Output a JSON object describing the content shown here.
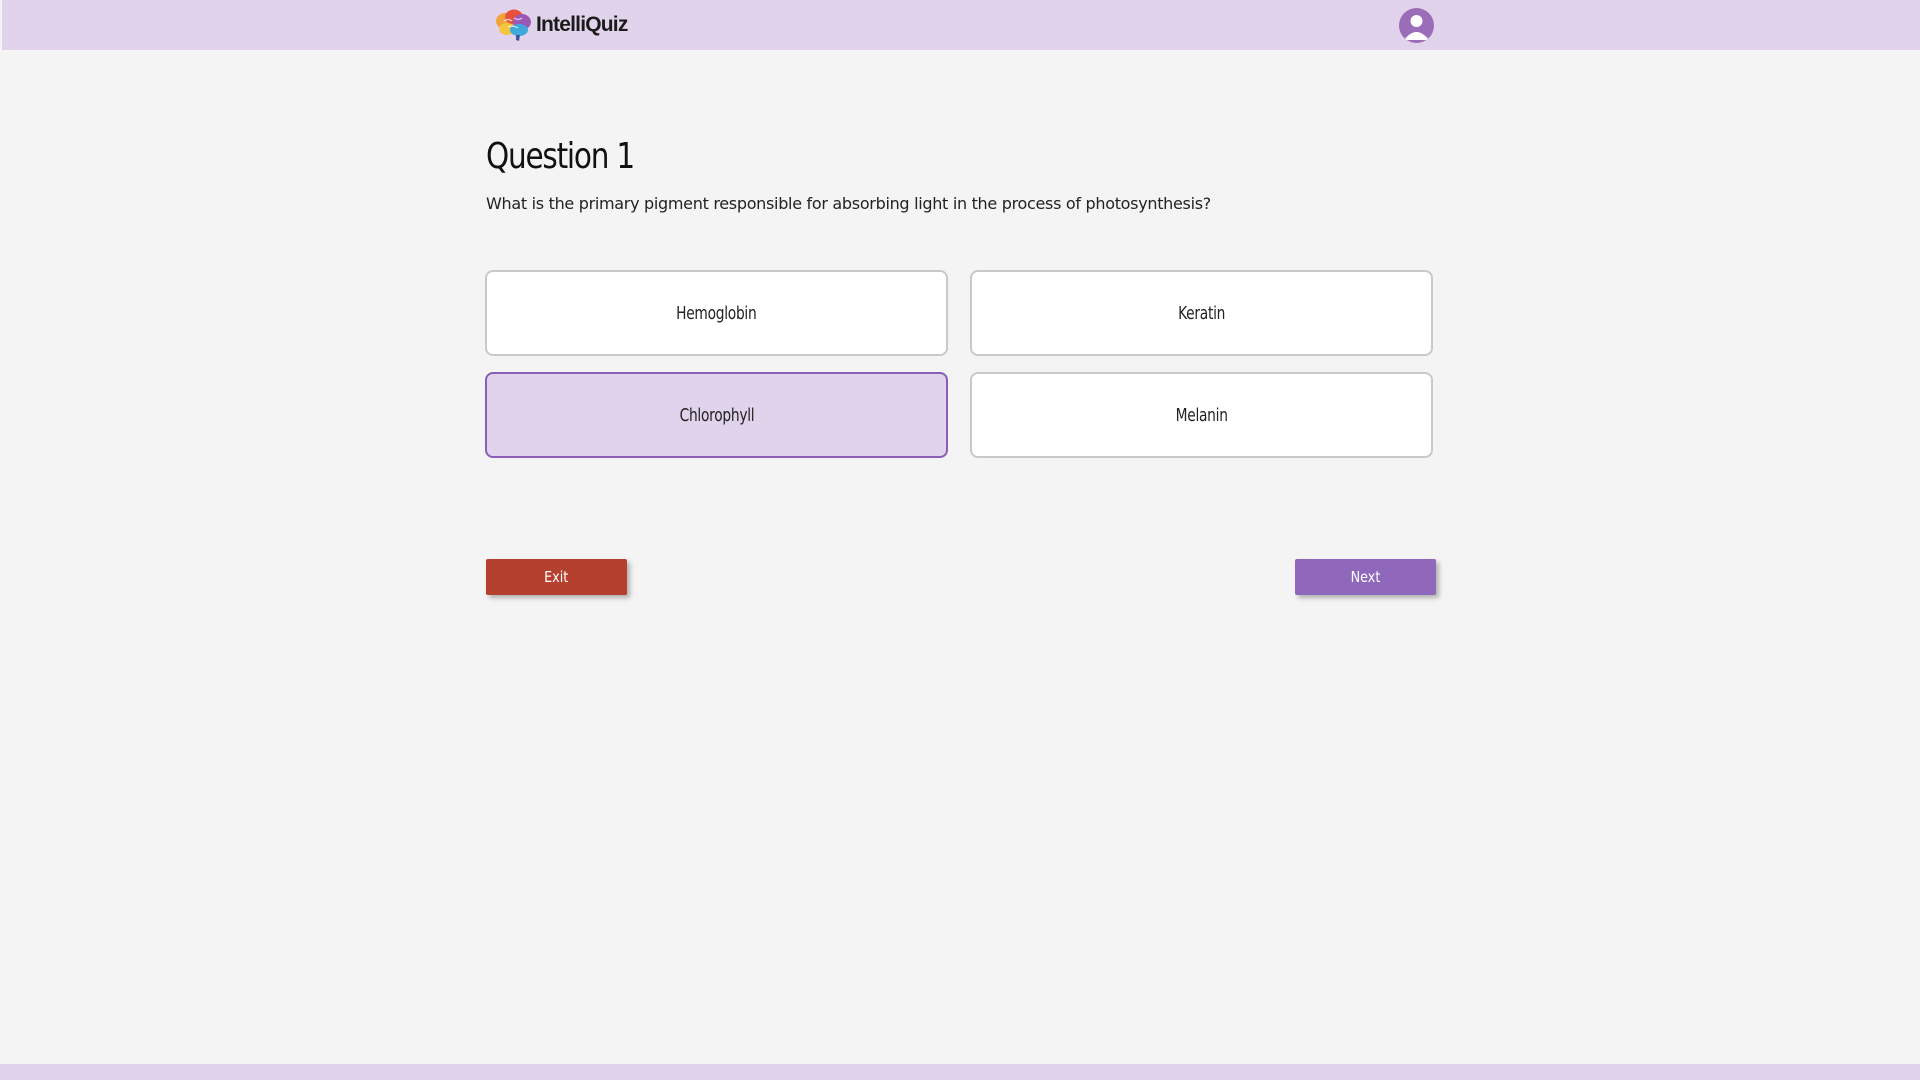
{
  "app": {
    "name": "IntelliQuiz",
    "logo_icon": "brain-icon",
    "profile_icon": "user-avatar-icon"
  },
  "question": {
    "title": "Question 1",
    "text": "What is the primary pigment responsible for absorbing light in the process of photosynthesis?"
  },
  "options": [
    {
      "label": "Hemoglobin",
      "selected": false
    },
    {
      "label": "Keratin",
      "selected": false
    },
    {
      "label": "Chlorophyll",
      "selected": true
    },
    {
      "label": "Melanin",
      "selected": false
    }
  ],
  "actions": {
    "exit_label": "Exit",
    "next_label": "Next"
  },
  "colors": {
    "header_bg": "#e1d3ec",
    "accent": "#9068bb",
    "selected_bg": "#e1d3ec",
    "selected_border": "#8a5db6",
    "exit_bg": "#b4402d",
    "page_bg": "#f4f4f4"
  }
}
